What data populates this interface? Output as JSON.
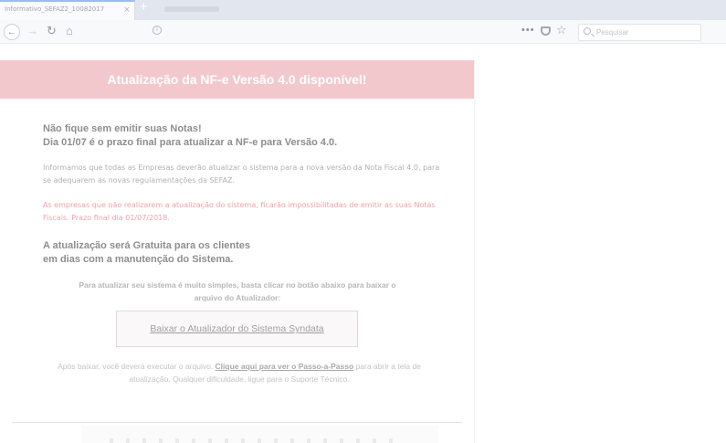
{
  "browser": {
    "tab_title": "Informativo_SEFAZ2_10082017",
    "tab_close": "×",
    "new_tab": "+",
    "search_placeholder": "Pesquisar",
    "menu_dots": "•••",
    "icons": {
      "back": "back-arrow-icon",
      "forward": "forward-arrow-icon",
      "reload": "reload-icon",
      "home": "home-icon",
      "info": "info-icon",
      "page_actions": "page-actions-icon",
      "pocket": "pocket-icon",
      "bookmark": "star-icon",
      "search": "search-icon"
    }
  },
  "page": {
    "banner_title": "Atualização da NF-e Versão 4.0 disponível!",
    "headline_1": "Não fique sem emitir suas Notas!",
    "headline_2": "Dia 01/07 é o prazo final para atualizar a NF-e para Versão 4.0.",
    "para_1": "Informamos que todas as Empresas deverão atualizar o sistema para a nova versão da Nota Fiscal 4.0, para se adequarem as novas regulamentações da SEFAZ.",
    "para_2": "As empresas que não realizarem a atualização do sistema, ficarão impossibilitadas de emitir as suas Notas Fiscais. Prazo final dia 01/07/2018.",
    "free_line_1": "A atualização será Gratuita para os clientes",
    "free_line_2": "em dias com a manutenção do Sistema.",
    "instructions": "Para atualizar seu sistema é muito simples, basta clicar no botão abaixo para baixar o arquivo do Atualizador:",
    "download_button": "Baixar o Atualizador do Sistema Syndata",
    "after_prefix": "Após baixar, você deverá executar o arquivo. ",
    "after_link": "Clique aqui para ver o Passo-a-Passo",
    "after_suffix": " para abrir a tela de atualização. Qualquer dificuldade, ligue para o Suporte Técnico."
  },
  "colors": {
    "banner": "#f3c8cd",
    "warning_text": "#f2a0ab",
    "tab_accent": "#9bbcf0"
  }
}
